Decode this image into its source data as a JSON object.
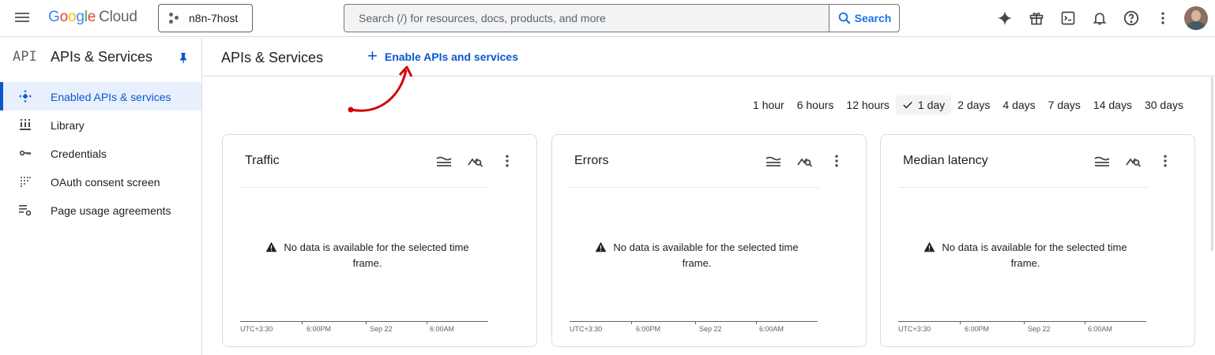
{
  "topbar": {
    "logo_google": [
      "G",
      "o",
      "o",
      "g",
      "l",
      "e"
    ],
    "logo_cloud": "Cloud",
    "project_name": "n8n-7host",
    "search_placeholder": "Search (/) for resources, docs, products, and more",
    "search_button": "Search",
    "icons": [
      "gemini-icon",
      "gift-icon",
      "terminal-icon",
      "bell-icon",
      "help-icon",
      "more-vert-icon"
    ]
  },
  "sidebar": {
    "logo_text": "API",
    "title": "APIs & Services",
    "items": [
      {
        "label": "Enabled APIs & services",
        "icon": "apis-icon",
        "active": true
      },
      {
        "label": "Library",
        "icon": "library-icon",
        "active": false
      },
      {
        "label": "Credentials",
        "icon": "key-icon",
        "active": false
      },
      {
        "label": "OAuth consent screen",
        "icon": "oauth-icon",
        "active": false
      },
      {
        "label": "Page usage agreements",
        "icon": "settings-list-icon",
        "active": false
      }
    ]
  },
  "main": {
    "title": "APIs & Services",
    "enable_button": "Enable APIs and services",
    "time_ranges": [
      {
        "label": "1 hour",
        "selected": false
      },
      {
        "label": "6 hours",
        "selected": false
      },
      {
        "label": "12 hours",
        "selected": false
      },
      {
        "label": "1 day",
        "selected": true
      },
      {
        "label": "2 days",
        "selected": false
      },
      {
        "label": "4 days",
        "selected": false
      },
      {
        "label": "7 days",
        "selected": false
      },
      {
        "label": "14 days",
        "selected": false
      },
      {
        "label": "30 days",
        "selected": false
      }
    ],
    "cards": [
      {
        "title": "Traffic",
        "message": "No data is available for the selected time frame.",
        "ticks": [
          "UTC+3:30",
          "6:00PM",
          "Sep 22",
          "6:00AM"
        ]
      },
      {
        "title": "Errors",
        "message": "No data is available for the selected time frame.",
        "ticks": [
          "UTC+3:30",
          "6:00PM",
          "Sep 22",
          "6:00AM"
        ]
      },
      {
        "title": "Median latency",
        "message": "No data is available for the selected time frame.",
        "ticks": [
          "UTC+3:30",
          "6:00PM",
          "Sep 22",
          "6:00AM"
        ]
      }
    ]
  },
  "colors": {
    "accent": "#0b57d0",
    "active_bg": "#e8f0fe",
    "arrow": "#d50000"
  }
}
